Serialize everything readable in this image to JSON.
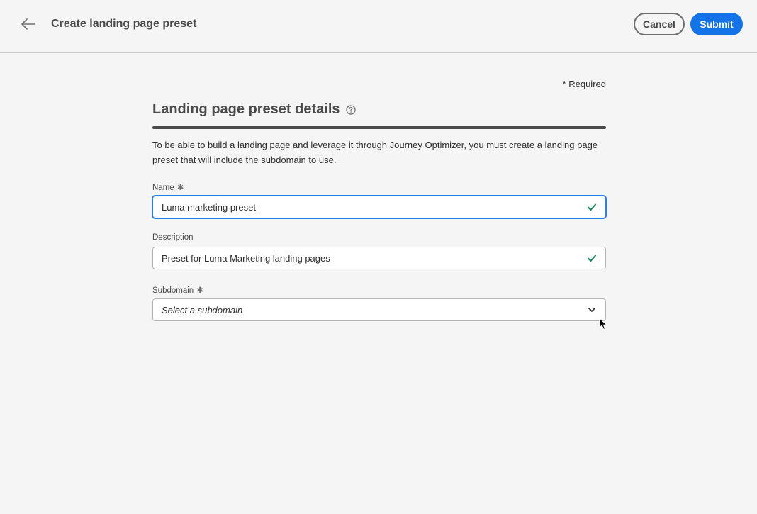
{
  "header": {
    "title": "Create landing page preset",
    "cancel_label": "Cancel",
    "submit_label": "Submit",
    "accent_color": "#1473e6"
  },
  "form": {
    "required_note": "* Required",
    "section_title": "Landing page preset details",
    "section_description": "To be able to build a landing page and leverage it through Journey Optimizer, you must create a landing page preset that will include the subdomain to use.",
    "fields": {
      "name": {
        "label": "Name",
        "required_mark": "✱",
        "value": "Luma marketing preset",
        "status_icon": "check-icon",
        "focused": true
      },
      "description": {
        "label": "Description",
        "value": "Preset for Luma Marketing landing pages",
        "status_icon": "check-icon"
      },
      "subdomain": {
        "label": "Subdomain",
        "required_mark": "✱",
        "placeholder": "Select a subdomain",
        "icon": "chevron-down-icon"
      }
    },
    "valid_color": "#12805c"
  }
}
